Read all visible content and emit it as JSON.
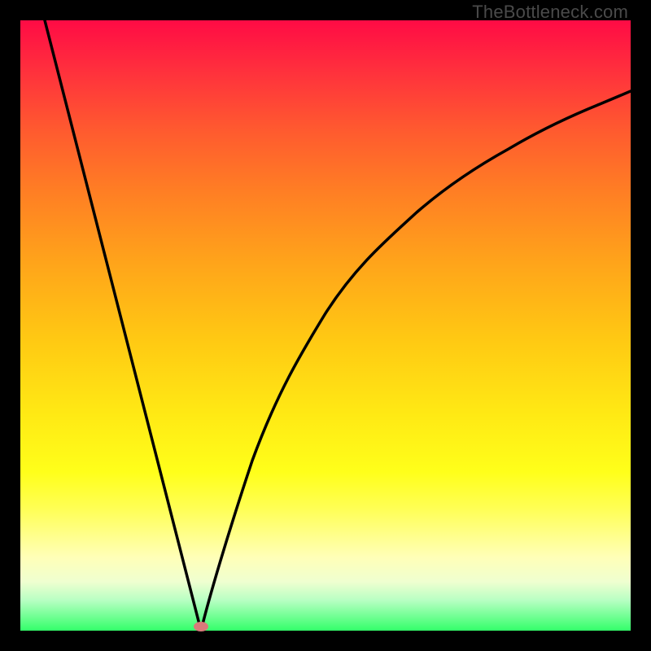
{
  "watermark": "TheBottleneck.com",
  "chart_data": {
    "type": "line",
    "title": "",
    "xlabel": "",
    "ylabel": "",
    "xlim": [
      0,
      100
    ],
    "ylim": [
      0,
      100
    ],
    "gradient_background": {
      "top_color": "#ff0b45",
      "bottom_color": "#33ff6a",
      "note": "red at top → orange → yellow → green at bottom"
    },
    "series": [
      {
        "name": "left-branch",
        "x": [
          4,
          10,
          16,
          22,
          27.5,
          29.6
        ],
        "y": [
          100,
          76.6,
          53.1,
          29.7,
          8.2,
          0
        ]
      },
      {
        "name": "right-branch",
        "x": [
          29.6,
          31,
          34,
          38,
          42,
          46,
          50,
          55,
          60,
          65,
          70,
          75,
          80,
          85,
          90,
          95,
          100
        ],
        "y": [
          0,
          5.1,
          15.9,
          27.8,
          37.5,
          45.4,
          52.0,
          58.6,
          64.0,
          68.5,
          72.3,
          75.6,
          78.5,
          81.0,
          83.2,
          85.1,
          86.8
        ]
      }
    ],
    "marker": {
      "x": 29.6,
      "y": 0.7,
      "shape": "ellipse",
      "color": "#d97a7a"
    }
  }
}
